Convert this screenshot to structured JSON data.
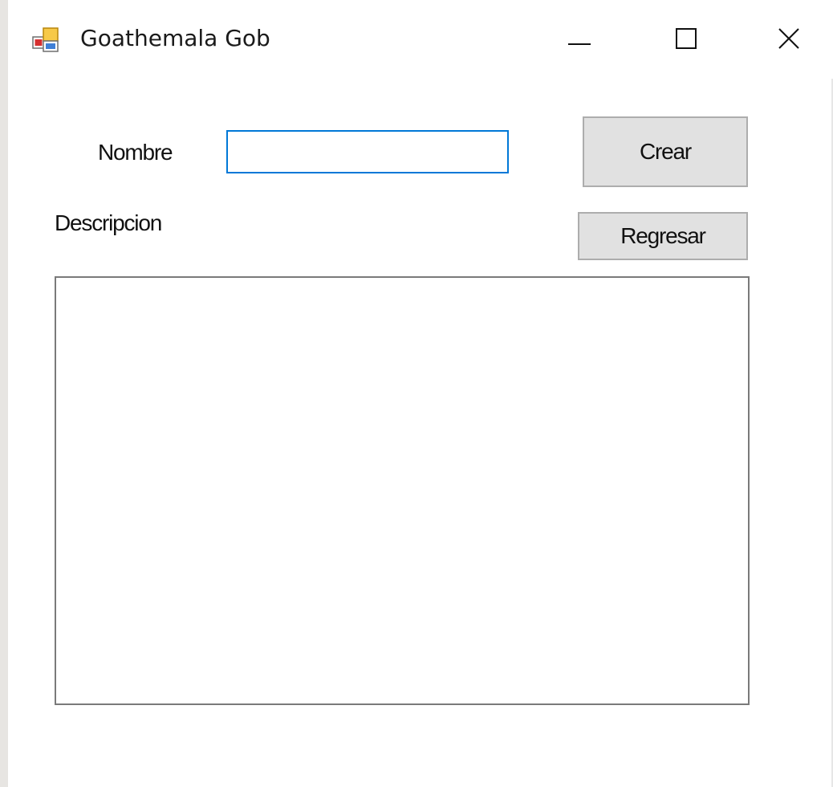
{
  "window": {
    "title": "Goathemala Gob",
    "icon": "windows-form-icon",
    "controls": {
      "minimize_icon": "minimize-icon",
      "maximize_icon": "maximize-icon",
      "close_icon": "close-icon"
    }
  },
  "form": {
    "nombre_label": "Nombre",
    "nombre_value": "",
    "descripcion_label": "Descripcion",
    "descripcion_value": "",
    "crear_label": "Crear",
    "regresar_label": "Regresar"
  },
  "colors": {
    "focus_border": "#0078d7",
    "button_face": "#e1e1e1",
    "button_border": "#adadad",
    "textarea_border": "#7a7a7a"
  }
}
